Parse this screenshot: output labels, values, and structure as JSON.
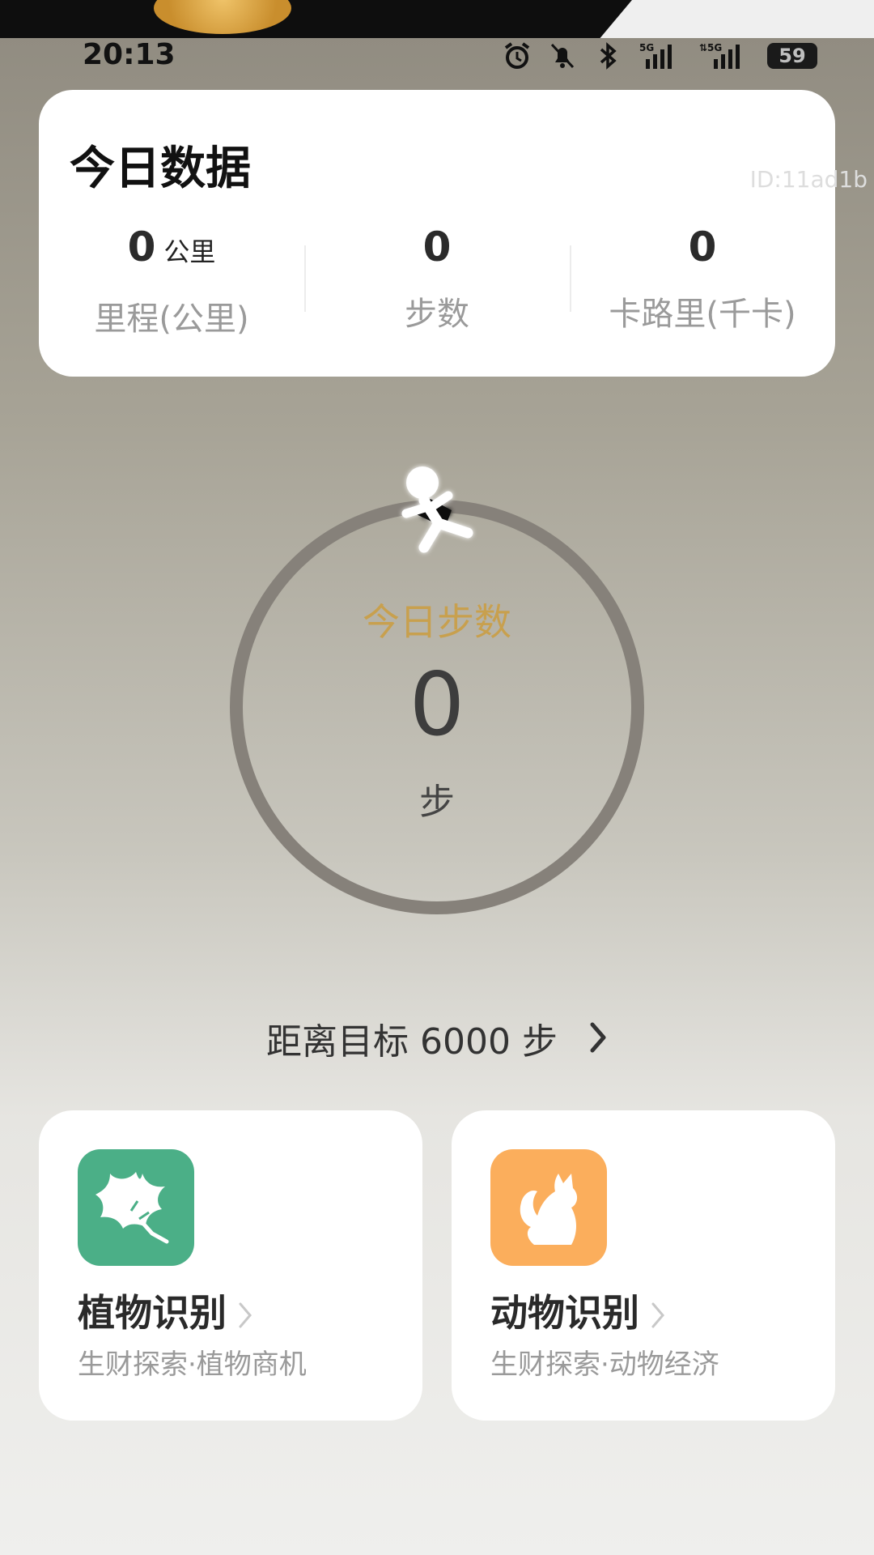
{
  "status_bar": {
    "time": "20:13",
    "battery": "59"
  },
  "today_card": {
    "title": "今日数据",
    "watermark": "ID:11ad1b",
    "stats": [
      {
        "value": "0",
        "unit": "公里",
        "label": "里程(公里)"
      },
      {
        "value": "0",
        "unit": "",
        "label": "步数"
      },
      {
        "value": "0",
        "unit": "",
        "label": "卡路里(千卡)"
      }
    ]
  },
  "steps_ring": {
    "label": "今日步数",
    "value": "0",
    "unit": "步",
    "progress": 0
  },
  "goal": {
    "text": "距离目标 6000 步"
  },
  "features": [
    {
      "title": "植物识别",
      "subtitle": "生财探索·植物商机",
      "icon": "leaf-icon",
      "color": "#4baf87"
    },
    {
      "title": "动物识别",
      "subtitle": "生财探索·动物经济",
      "icon": "cat-icon",
      "color": "#fbae5c"
    }
  ]
}
